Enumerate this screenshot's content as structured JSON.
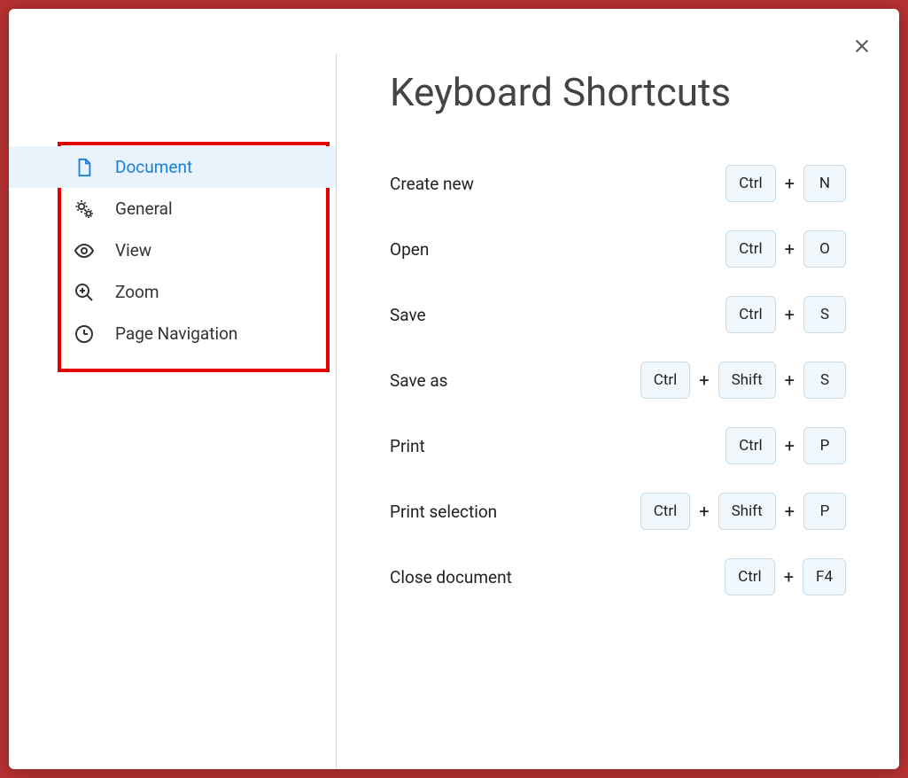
{
  "dialog": {
    "title": "Keyboard Shortcuts"
  },
  "sidebar": {
    "items": [
      {
        "label": "Document",
        "icon": "document-icon",
        "active": true
      },
      {
        "label": "General",
        "icon": "gear-icon",
        "active": false
      },
      {
        "label": "View",
        "icon": "eye-icon",
        "active": false
      },
      {
        "label": "Zoom",
        "icon": "zoom-icon",
        "active": false
      },
      {
        "label": "Page Navigation",
        "icon": "clock-icon",
        "active": false
      }
    ]
  },
  "shortcuts": [
    {
      "label": "Create new",
      "keys": [
        "Ctrl",
        "N"
      ]
    },
    {
      "label": "Open",
      "keys": [
        "Ctrl",
        "O"
      ]
    },
    {
      "label": "Save",
      "keys": [
        "Ctrl",
        "S"
      ]
    },
    {
      "label": "Save as",
      "keys": [
        "Ctrl",
        "Shift",
        "S"
      ]
    },
    {
      "label": "Print",
      "keys": [
        "Ctrl",
        "P"
      ]
    },
    {
      "label": "Print selection",
      "keys": [
        "Ctrl",
        "Shift",
        "P"
      ]
    },
    {
      "label": "Close document",
      "keys": [
        "Ctrl",
        "F4"
      ]
    }
  ],
  "plus": "+"
}
